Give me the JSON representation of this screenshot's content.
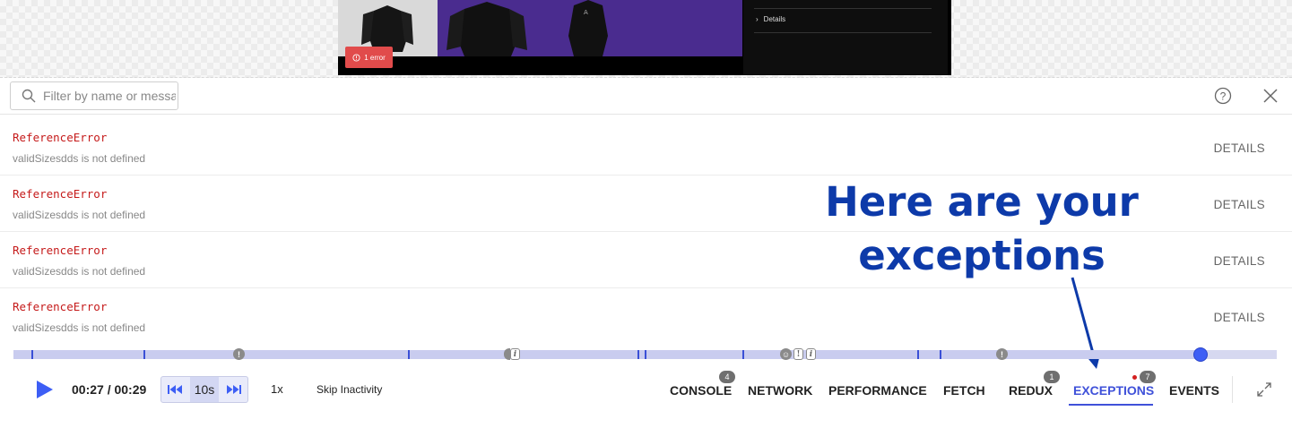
{
  "preview": {
    "detail_label": "Details",
    "error_chip": "1 error"
  },
  "filter": {
    "placeholder": "Filter by name or message"
  },
  "exceptions": [
    {
      "name": "ReferenceError",
      "message": "validSizesdds is not defined",
      "action": "DETAILS"
    },
    {
      "name": "ReferenceError",
      "message": "validSizesdds is not defined",
      "action": "DETAILS"
    },
    {
      "name": "ReferenceError",
      "message": "validSizesdds is not defined",
      "action": "DETAILS"
    },
    {
      "name": "ReferenceError",
      "message": "validSizesdds is not defined",
      "action": "DETAILS"
    }
  ],
  "annotation": {
    "line1": "Here are your",
    "line2": "exceptions",
    "color": "#0d3aa9"
  },
  "player": {
    "time": "00:27 / 00:29",
    "skip_seconds": "10s",
    "speed": "1x",
    "skip_inactivity": "Skip Inactivity",
    "progress_fraction": 0.94
  },
  "tabs": [
    {
      "label": "CONSOLE",
      "badge": "4"
    },
    {
      "label": "NETWORK",
      "badge": ""
    },
    {
      "label": "PERFORMANCE",
      "badge": ""
    },
    {
      "label": "FETCH",
      "badge": ""
    },
    {
      "label": "REDUX",
      "badge": "1"
    },
    {
      "label": "EXCEPTIONS",
      "badge": "7",
      "active": true
    },
    {
      "label": "EVENTS",
      "badge": ""
    }
  ],
  "colors": {
    "accent": "#3f51d9",
    "error": "#c51a1a"
  }
}
